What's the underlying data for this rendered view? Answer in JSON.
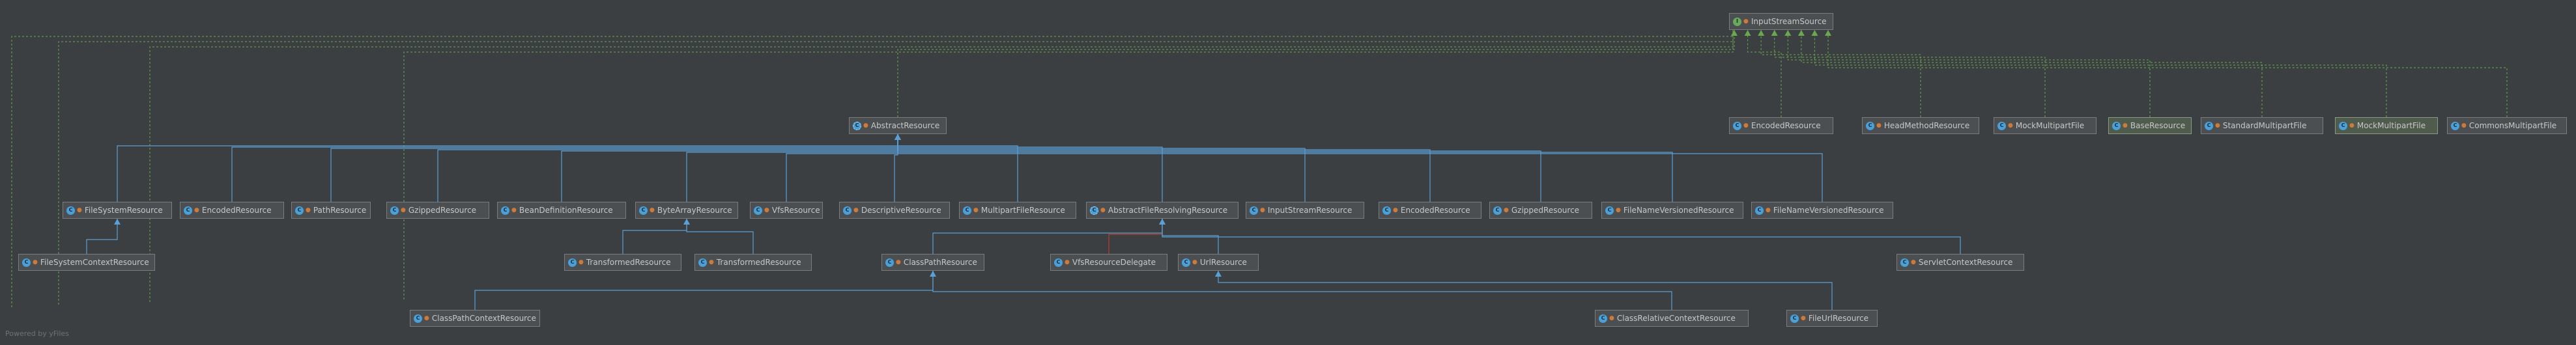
{
  "diagram": {
    "type": "uml-class-hierarchy",
    "root": "InputStreamSource",
    "nodes": [
      {
        "id": "inputstreamsource",
        "label": "InputStreamSource",
        "kind": "interface"
      },
      {
        "id": "abstractresource",
        "label": "AbstractResource",
        "kind": "abstract"
      },
      {
        "id": "encodedresource_top",
        "label": "EncodedResource",
        "kind": "class"
      },
      {
        "id": "headmethodresource",
        "label": "HeadMethodResource",
        "kind": "class"
      },
      {
        "id": "mockmultipartfile_top",
        "label": "MockMultipartFile",
        "kind": "class"
      },
      {
        "id": "base_resource",
        "label": "BaseResource",
        "kind": "class",
        "highlight": true
      },
      {
        "id": "standardmultipartfile",
        "label": "StandardMultipartFile",
        "kind": "class"
      },
      {
        "id": "mockmultipartfile_hl",
        "label": "MockMultipartFile",
        "kind": "class",
        "highlight": true
      },
      {
        "id": "commonsmultipartfile",
        "label": "CommonsMultipartFile",
        "kind": "class"
      },
      {
        "id": "filesystemresource",
        "label": "FileSystemResource",
        "kind": "class"
      },
      {
        "id": "encodedresource_mid",
        "label": "EncodedResource",
        "kind": "class"
      },
      {
        "id": "pathresource",
        "label": "PathResource",
        "kind": "class"
      },
      {
        "id": "gzippedresource_l",
        "label": "GzippedResource",
        "kind": "class"
      },
      {
        "id": "beandefinitionresource",
        "label": "BeanDefinitionResource",
        "kind": "class"
      },
      {
        "id": "bytearrayresource",
        "label": "ByteArrayResource",
        "kind": "class"
      },
      {
        "id": "vfsresource",
        "label": "VfsResource",
        "kind": "class"
      },
      {
        "id": "descriptiveresource",
        "label": "DescriptiveResource",
        "kind": "class"
      },
      {
        "id": "multipartfileresource",
        "label": "MultipartFileResource",
        "kind": "class"
      },
      {
        "id": "abstractfileresolvingresource",
        "label": "AbstractFileResolvingResource",
        "kind": "abstract"
      },
      {
        "id": "inputstreamresource",
        "label": "InputStreamResource",
        "kind": "class"
      },
      {
        "id": "encodedresource_r",
        "label": "EncodedResource",
        "kind": "class"
      },
      {
        "id": "gzippedresource_r",
        "label": "GzippedResource",
        "kind": "class"
      },
      {
        "id": "filenameversionedresource_a",
        "label": "FileNameVersionedResource",
        "kind": "class"
      },
      {
        "id": "filenameversionedresource_b",
        "label": "FileNameVersionedResource",
        "kind": "class"
      },
      {
        "id": "filesystemcontextresource",
        "label": "FileSystemContextResource",
        "kind": "class"
      },
      {
        "id": "transformedresource_a",
        "label": "TransformedResource",
        "kind": "class"
      },
      {
        "id": "transformedresource_b",
        "label": "TransformedResource",
        "kind": "class"
      },
      {
        "id": "classpathresource",
        "label": "ClassPathResource",
        "kind": "class"
      },
      {
        "id": "vfsresourcedelegate",
        "label": "VfsResourceDelegate",
        "kind": "class"
      },
      {
        "id": "urlresource",
        "label": "UrlResource",
        "kind": "class"
      },
      {
        "id": "servletcontextresource",
        "label": "ServletContextResource",
        "kind": "class"
      },
      {
        "id": "classpathcontextresource",
        "label": "ClassPathContextResource",
        "kind": "class"
      },
      {
        "id": "classrelativecontextresource",
        "label": "ClassRelativeContextResource",
        "kind": "class"
      },
      {
        "id": "fileurlresource",
        "label": "FileUrlResource",
        "kind": "class"
      }
    ],
    "edges": [
      {
        "from": "abstractresource",
        "to": "inputstreamsource",
        "type": "implements"
      },
      {
        "from": "encodedresource_top",
        "to": "inputstreamsource",
        "type": "implements"
      },
      {
        "from": "headmethodresource",
        "to": "inputstreamsource",
        "type": "implements"
      },
      {
        "from": "mockmultipartfile_top",
        "to": "inputstreamsource",
        "type": "implements"
      },
      {
        "from": "base_resource",
        "to": "inputstreamsource",
        "type": "implements"
      },
      {
        "from": "standardmultipartfile",
        "to": "inputstreamsource",
        "type": "implements"
      },
      {
        "from": "mockmultipartfile_hl",
        "to": "inputstreamsource",
        "type": "implements"
      },
      {
        "from": "commonsmultipartfile",
        "to": "inputstreamsource",
        "type": "implements"
      },
      {
        "from": "filesystemresource",
        "to": "abstractresource",
        "type": "extends"
      },
      {
        "from": "encodedresource_mid",
        "to": "abstractresource",
        "type": "extends"
      },
      {
        "from": "pathresource",
        "to": "abstractresource",
        "type": "extends"
      },
      {
        "from": "gzippedresource_l",
        "to": "abstractresource",
        "type": "extends"
      },
      {
        "from": "beandefinitionresource",
        "to": "abstractresource",
        "type": "extends"
      },
      {
        "from": "bytearrayresource",
        "to": "abstractresource",
        "type": "extends"
      },
      {
        "from": "vfsresource",
        "to": "abstractresource",
        "type": "extends"
      },
      {
        "from": "descriptiveresource",
        "to": "abstractresource",
        "type": "extends"
      },
      {
        "from": "multipartfileresource",
        "to": "abstractresource",
        "type": "extends"
      },
      {
        "from": "abstractfileresolvingresource",
        "to": "abstractresource",
        "type": "extends"
      },
      {
        "from": "inputstreamresource",
        "to": "abstractresource",
        "type": "extends"
      },
      {
        "from": "encodedresource_r",
        "to": "abstractresource",
        "type": "extends"
      },
      {
        "from": "gzippedresource_r",
        "to": "abstractresource",
        "type": "extends"
      },
      {
        "from": "filenameversionedresource_a",
        "to": "abstractresource",
        "type": "extends"
      },
      {
        "from": "filenameversionedresource_b",
        "to": "abstractresource",
        "type": "extends"
      },
      {
        "from": "filesystemcontextresource",
        "to": "filesystemresource",
        "type": "extends"
      },
      {
        "from": "transformedresource_a",
        "to": "bytearrayresource",
        "type": "extends"
      },
      {
        "from": "transformedresource_b",
        "to": "bytearrayresource",
        "type": "extends"
      },
      {
        "from": "classpathresource",
        "to": "abstractfileresolvingresource",
        "type": "extends"
      },
      {
        "from": "vfsresourcedelegate",
        "to": "abstractfileresolvingresource",
        "type": "inner"
      },
      {
        "from": "urlresource",
        "to": "abstractfileresolvingresource",
        "type": "extends"
      },
      {
        "from": "servletcontextresource",
        "to": "abstractfileresolvingresource",
        "type": "extends"
      },
      {
        "from": "classpathcontextresource",
        "to": "classpathresource",
        "type": "extends"
      },
      {
        "from": "classrelativecontextresource",
        "to": "classpathresource",
        "type": "extends"
      },
      {
        "from": "fileurlresource",
        "to": "urlresource",
        "type": "extends"
      }
    ],
    "colors": {
      "background": "#3c3f41",
      "extends_edge": "#5a9fd6",
      "implements_edge": "#6aa84f",
      "inner_edge": "#c0392b",
      "node_fill": "#4b4f51",
      "node_border": "#7a7d80",
      "node_text": "#c8c8c8"
    }
  },
  "footer": {
    "text": "Powered by yFiles"
  }
}
